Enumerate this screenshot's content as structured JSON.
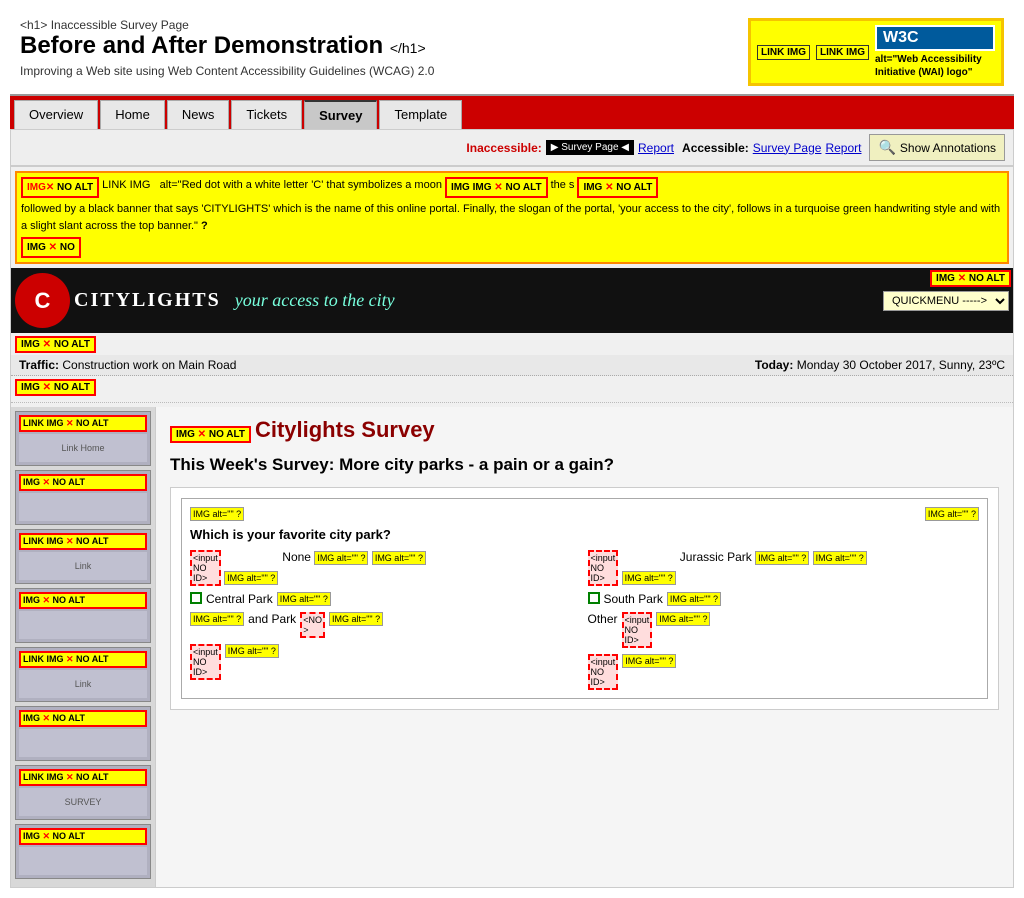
{
  "page": {
    "header": {
      "h2": "<h1>",
      "title_line1": "Inaccessible Survey Page",
      "title_bold": "Before and After Demonstration",
      "title_end": "</h1>",
      "subtitle": "Improving a Web site using Web Content Accessibility Guidelines (WCAG) 2.0"
    },
    "w3c_badge": {
      "prefix1": "LINK IMG",
      "prefix2": "LINK IMG",
      "alt_label": "alt=\"Web Accessibility Initiative (WAI) logo\"",
      "w3c_text": "W3C",
      "extra": ""
    },
    "nav": {
      "tabs": [
        "Overview",
        "Home",
        "News",
        "Tickets",
        "Survey",
        "Template"
      ],
      "active": "Survey"
    },
    "acc_bar": {
      "inaccessible_label": "Inaccessible:",
      "inaccessible_arrow": "▶ Survey Page ◀",
      "inaccessible_report": "Report",
      "accessible_label": "Accessible:",
      "accessible_link": "Survey Page",
      "accessible_report": "Report",
      "show_btn": "Show Annotations"
    },
    "annotation_banner": {
      "img_no_alt_left": "IMGX NO ALT",
      "link_img_text": "LINK IMG  alt=\"Red dot with a white letter 'C' that symbolizes a moon",
      "img_x1": "IMG IMG X NO ALT",
      "img_x2": "the s IMG X NO ALT",
      "rest_text": " followed by a black banner that says 'CITYLIGHTS' which is the name of this online portal. Finally, the slogan of the portal, 'your access to the city', follows in a turquoise green handwriting style and with a slight slant across the top banner.\"",
      "question_mark": "?",
      "img_no_alt_right": "IMGX NO"
    },
    "site_banner": {
      "logo_letter": "C",
      "site_name": "CITYLIGHTS",
      "slogan": "your access to the city",
      "quickmenu": "QUICKMENU ----->  ÷"
    },
    "traffic": {
      "label": "Traffic:",
      "value": "Construction work on Main Road",
      "today_label": "Today:",
      "today_value": "Monday 30 October 2017, Sunny, 23ºC"
    },
    "sidebar": {
      "items": [
        {
          "ann": "LINK IMG X NO ALT",
          "img_text": "Link Home"
        },
        {
          "ann": "IMG X NO ALT",
          "img_text": ""
        },
        {
          "ann": "LINK IMG X NO ALT",
          "img_text": "Link"
        },
        {
          "ann": "IMG X NO ALT",
          "img_text": ""
        },
        {
          "ann": "LINK IMG X NO ALT",
          "img_text": "Link"
        },
        {
          "ann": "IMG X NO ALT",
          "img_text": ""
        },
        {
          "ann": "LINK IMG X NO ALT",
          "img_text": "SURVEY"
        },
        {
          "ann": "IMG X NO ALT",
          "img_text": ""
        }
      ]
    },
    "survey": {
      "banner_ann": "IMG X NO ALT",
      "title": "Citylights Survey",
      "question_title": "This Week's Survey: More city parks - a pain or a gain?",
      "box_img_ann1": "IMG  alt=\"\"  ?",
      "box_img_ann2": "IMG  alt=\"\"  ?",
      "question": "Which is your favorite city park?",
      "options": [
        {
          "col": 1,
          "entries": [
            {
              "label": "None",
              "input_ann": "<input\nNO\nID>",
              "img_ann1": "IMG  alt=\"\"  ?",
              "img_ann2": "IMG  alt=\"\"  ?"
            },
            {
              "label": "Central Park",
              "img_ann": "IMG  alt=\"\"  ?"
            },
            {
              "label": "and Park",
              "img_ann1": "IMG  alt=\"\"  ?",
              "img_ann2": "IMG  alt=\"\"  ?"
            },
            {
              "input_ann": "<input\nNO\nID>",
              "img_ann": "IMG  alt=\"\"  ?"
            }
          ]
        },
        {
          "col": 2,
          "entries": [
            {
              "label": "Jurassic Park",
              "input_ann": "<input\nNO\nID>",
              "img_ann1": "IMG  alt=\"\"  ?",
              "img_ann2": "IMG  alt=\"\"  ?"
            },
            {
              "label": "South Park",
              "img_ann": "IMG  alt=\"\"  ?"
            },
            {
              "label": "Other",
              "input_ann": "<input\nNO\nID>",
              "img_ann": "IMG  alt=\"\"  ?"
            },
            {
              "input_ann": "<input\nNO\nID>",
              "img_ann": "IMG  alt=\"\"  ?"
            }
          ]
        }
      ]
    }
  }
}
